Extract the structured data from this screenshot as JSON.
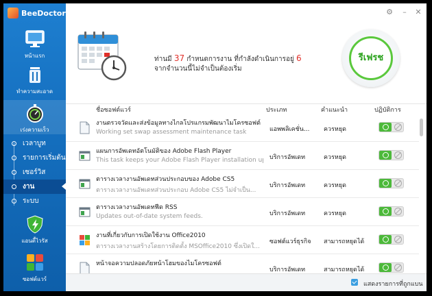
{
  "app": {
    "title": "BeeDoctor"
  },
  "sidebar": {
    "home": "หน้าแรก",
    "clean": "ทำความสะอาด",
    "speed": "เร่งความเร็ว",
    "boot": "เวลาบูท",
    "startup": "รายการเริ่มต้น",
    "services": "เซอร์วิส",
    "tasks": "งาน",
    "system": "ระบบ",
    "antivirus": "แอนตี้ไวรัส",
    "software": "ซอฟต์แวร์"
  },
  "summary": {
    "part1": "ท่านมี ",
    "total": "37",
    "part2": " กำหนดการงาน  ที่กำลังดำเนินการอยู่ ",
    "running": "6",
    "line2": "จากจำนวนนี้ไม่จำเป็นต้องเริ่ม"
  },
  "refresh_label": "รีเฟรช",
  "table": {
    "headers": {
      "name": "ชื่อซอฟต์แวร์",
      "type": "ประเภท",
      "advice": "คำแนะนำ",
      "action": "ปฏิบัติการ"
    },
    "rows": [
      {
        "name": "งานตรวจวัดและส่งข้อมูลทางไกลโปรแกรมพัฒนาไมโครซอฟต์",
        "desc": "Working set swap assessment maintenance task",
        "type": "แอพพลิเคชั่น...",
        "advice": "ควรหยุด",
        "icon": "document-icon"
      },
      {
        "name": "แผนการอัพเดทอัตโนมัติของ Adobe Flash Player",
        "desc": "This task keeps your Adobe Flash Player installation up ...",
        "type": "บริการอัพเดท",
        "advice": "ควรหยุด",
        "icon": "app-window-icon"
      },
      {
        "name": "ตารางเวลางานอัพเดทส่วนประกอบของ Adobe CS5",
        "desc": "ตารางเวลางานอัพเดทส่วนประกอบ Adobe CS5 ไม่จำเป็น...",
        "type": "บริการอัพเดท",
        "advice": "ควรหยุด",
        "icon": "app-window-icon"
      },
      {
        "name": "ตารางเวลางานอัพเดทฟีด RSS",
        "desc": "Updates out-of-date system feeds.",
        "type": "บริการอัพเดท",
        "advice": "ควรหยุด",
        "icon": "app-window-icon"
      },
      {
        "name": "งานที่เกี่ยวกับการเปิดใช้งาน Office2010",
        "desc": "ตารางเวลางานสร้างโดยการติดตั้ง MSOffice2010 ซึ่งเปิดใ...",
        "type": "ซอฟต์แวร์ธุรกิจ",
        "advice": "สามารถหยุดได้",
        "icon": "office-icon"
      },
      {
        "name": "หน้าจอความปลอดภัยหน้าโฮมของไมโครซอฟต์",
        "desc": "",
        "type": "บริการอัพเดท",
        "advice": "สามารถหยุดได้",
        "icon": "document-icon"
      }
    ]
  },
  "footer": {
    "show_ignored": "แสดงรายการที่ถูกแบน"
  },
  "colors": {
    "sidebar": "#1570c0",
    "accent_green": "#4cb93a",
    "highlight_red": "#e0302a"
  }
}
